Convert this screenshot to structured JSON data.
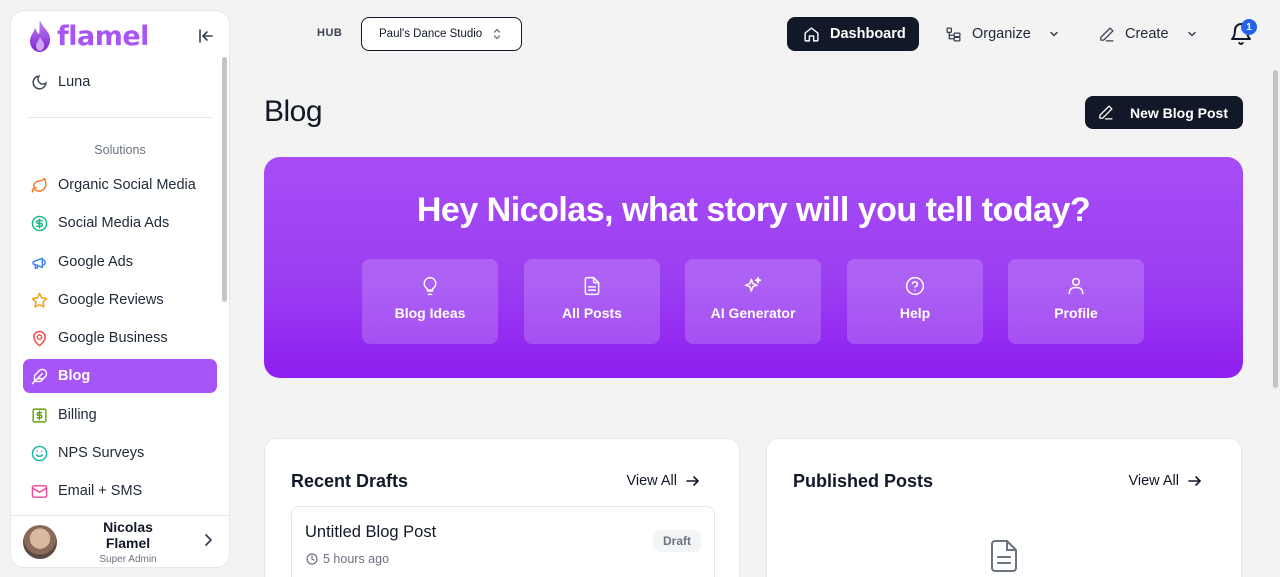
{
  "brand": {
    "name": "flamel",
    "color": "#a855f7"
  },
  "sidebar": {
    "top_item": {
      "label": "Luna",
      "icon": "moon-icon"
    },
    "section_label": "Solutions",
    "items": [
      {
        "label": "Organic Social Media",
        "icon": "leaf-icon",
        "color": "#f97316"
      },
      {
        "label": "Social Media Ads",
        "icon": "dollar-circle-icon",
        "color": "#10b981"
      },
      {
        "label": "Google Ads",
        "icon": "megaphone-icon",
        "color": "#3b82f6"
      },
      {
        "label": "Google Reviews",
        "icon": "star-icon",
        "color": "#f59e0b"
      },
      {
        "label": "Google Business",
        "icon": "map-pin-icon",
        "color": "#ef4444"
      },
      {
        "label": "Blog",
        "icon": "feather-icon",
        "color": "#ffffff",
        "active": true
      },
      {
        "label": "Billing",
        "icon": "dollar-square-icon",
        "color": "#65a30d"
      },
      {
        "label": "NPS Surveys",
        "icon": "smile-icon",
        "color": "#14b8a6"
      },
      {
        "label": "Email + SMS",
        "icon": "mail-icon",
        "color": "#ec4899"
      }
    ],
    "user": {
      "name": "Nicolas Flamel",
      "role": "Super Admin"
    }
  },
  "topbar": {
    "hub_label": "HUB",
    "studio": "Paul's Dance Studio",
    "dashboard": "Dashboard",
    "organize": "Organize",
    "create": "Create",
    "notifications_count": "1"
  },
  "page": {
    "title": "Blog",
    "new_post_button": "New Blog Post"
  },
  "hero": {
    "title": "Hey Nicolas, what story will you tell today?",
    "tiles": [
      {
        "label": "Blog Ideas",
        "icon": "lightbulb-icon"
      },
      {
        "label": "All Posts",
        "icon": "document-icon"
      },
      {
        "label": "AI Generator",
        "icon": "sparkles-icon"
      },
      {
        "label": "Help",
        "icon": "help-circle-icon"
      },
      {
        "label": "Profile",
        "icon": "user-icon"
      }
    ]
  },
  "drafts": {
    "title": "Recent Drafts",
    "view_all": "View All",
    "items": [
      {
        "title": "Untitled Blog Post",
        "time": "5 hours ago",
        "status": "Draft"
      }
    ]
  },
  "published": {
    "title": "Published Posts",
    "view_all": "View All"
  }
}
